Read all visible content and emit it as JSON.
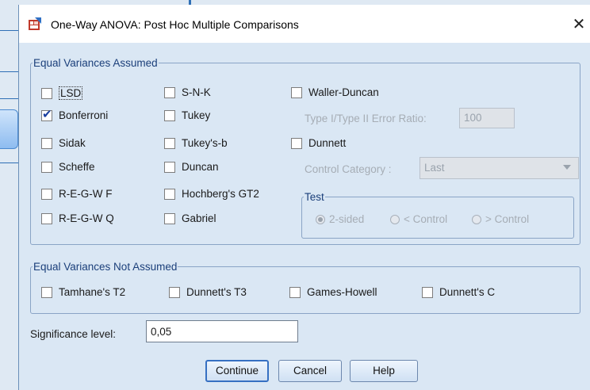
{
  "dialog": {
    "title": "One-Way ANOVA: Post Hoc Multiple Comparisons",
    "close_icon": "close-icon"
  },
  "equal_assumed": {
    "legend": "Equal Variances Assumed",
    "items": {
      "lsd": {
        "label": "LSD",
        "checked": false
      },
      "bonferroni": {
        "label": "Bonferroni",
        "checked": true
      },
      "sidak": {
        "label": "Sidak",
        "checked": false
      },
      "scheffe": {
        "label": "Scheffe",
        "checked": false
      },
      "regwf": {
        "label": "R-E-G-W F",
        "checked": false
      },
      "regwq": {
        "label": "R-E-G-W Q",
        "checked": false
      },
      "snk": {
        "label": "S-N-K",
        "checked": false
      },
      "tukey": {
        "label": "Tukey",
        "checked": false
      },
      "tukeyb": {
        "label": "Tukey's-b",
        "checked": false
      },
      "duncan": {
        "label": "Duncan",
        "checked": false
      },
      "hochberg": {
        "label": "Hochberg's GT2",
        "checked": false
      },
      "gabriel": {
        "label": "Gabriel",
        "checked": false
      },
      "waller": {
        "label": "Waller-Duncan",
        "checked": false
      },
      "dunnett": {
        "label": "Dunnett",
        "checked": false
      }
    },
    "error_ratio_label": "Type I/Type II Error Ratio:",
    "error_ratio_value": "100",
    "control_category_label": "Control Category :",
    "control_category_value": "Last",
    "test": {
      "legend": "Test",
      "options": [
        "2-sided",
        "< Control",
        "> Control"
      ],
      "selected": "2-sided"
    }
  },
  "equal_not_assumed": {
    "legend": "Equal Variances Not Assumed",
    "items": {
      "tamhane": {
        "label": "Tamhane's T2",
        "checked": false
      },
      "dunnett_t3": {
        "label": "Dunnett's T3",
        "checked": false
      },
      "games_howell": {
        "label": "Games-Howell",
        "checked": false
      },
      "dunnett_c": {
        "label": "Dunnett's C",
        "checked": false
      }
    }
  },
  "significance": {
    "label": "Significance level:",
    "value": "0,05"
  },
  "buttons": {
    "continue": "Continue",
    "cancel": "Cancel",
    "help": "Help"
  }
}
